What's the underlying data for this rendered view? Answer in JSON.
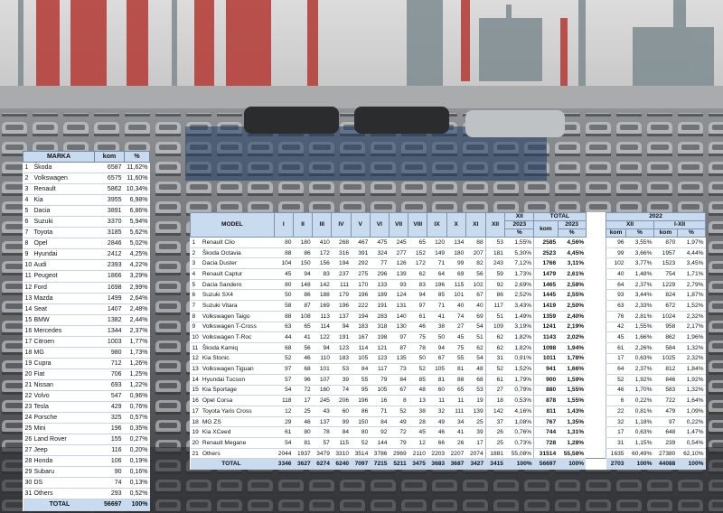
{
  "brands": {
    "headers": [
      "MARKA",
      "kom",
      "%"
    ],
    "rows": [
      [
        "1",
        "Škoda",
        "6587",
        "11,62%"
      ],
      [
        "2",
        "Volkswagen",
        "6575",
        "11,60%"
      ],
      [
        "3",
        "Renault",
        "5862",
        "10,34%"
      ],
      [
        "4",
        "Kia",
        "3955",
        "6,98%"
      ],
      [
        "5",
        "Dacia",
        "3891",
        "6,86%"
      ],
      [
        "6",
        "Suzuki",
        "3370",
        "5,94%"
      ],
      [
        "7",
        "Toyota",
        "3185",
        "5,62%"
      ],
      [
        "8",
        "Opel",
        "2846",
        "5,02%"
      ],
      [
        "9",
        "Hyundai",
        "2412",
        "4,25%"
      ],
      [
        "10",
        "Audi",
        "2393",
        "4,22%"
      ],
      [
        "11",
        "Peugeot",
        "1866",
        "3,29%"
      ],
      [
        "12",
        "Ford",
        "1698",
        "2,99%"
      ],
      [
        "13",
        "Mazda",
        "1499",
        "2,64%"
      ],
      [
        "14",
        "Seat",
        "1407",
        "2,48%"
      ],
      [
        "15",
        "BMW",
        "1382",
        "2,44%"
      ],
      [
        "16",
        "Mercedes",
        "1344",
        "2,37%"
      ],
      [
        "17",
        "Citroen",
        "1003",
        "1,77%"
      ],
      [
        "18",
        "MG",
        "980",
        "1,73%"
      ],
      [
        "19",
        "Cupra",
        "712",
        "1,26%"
      ],
      [
        "20",
        "Fiat",
        "706",
        "1,25%"
      ],
      [
        "21",
        "Nissan",
        "693",
        "1,22%"
      ],
      [
        "22",
        "Volvo",
        "547",
        "0,96%"
      ],
      [
        "23",
        "Tesla",
        "429",
        "0,76%"
      ],
      [
        "24",
        "Porsche",
        "325",
        "0,57%"
      ],
      [
        "25",
        "Mini",
        "196",
        "0,35%"
      ],
      [
        "26",
        "Land Rover",
        "155",
        "0,27%"
      ],
      [
        "27",
        "Jeep",
        "116",
        "0,20%"
      ],
      [
        "28",
        "Honda",
        "106",
        "0,19%"
      ],
      [
        "29",
        "Subaru",
        "90",
        "0,16%"
      ],
      [
        "30",
        "DS",
        "74",
        "0,13%"
      ],
      [
        "31",
        "Others",
        "293",
        "0,52%"
      ]
    ],
    "total": [
      "TOTAL",
      "56697",
      "100%"
    ]
  },
  "models": {
    "head": {
      "model": "MODEL",
      "months": [
        "I",
        "II",
        "III",
        "IV",
        "V",
        "VI",
        "VII",
        "VIII",
        "IX",
        "X",
        "XI",
        "XII"
      ],
      "xii": "XII",
      "xii_year": "2023",
      "xii_pct": "%",
      "total": "TOTAL",
      "total_year": "2023",
      "total_kom": "kom",
      "total_pct": "%",
      "prev_year": "2022",
      "prev_xii": "XII",
      "prev_ixii": "I-XII",
      "kom": "kom",
      "pct": "%"
    },
    "rows": [
      [
        "1",
        "Renault Clio",
        "80",
        "180",
        "410",
        "268",
        "467",
        "475",
        "245",
        "65",
        "120",
        "134",
        "88",
        "53",
        "1,55%",
        "2585",
        "4,56%",
        "96",
        "3,55%",
        "870",
        "1,97%"
      ],
      [
        "2",
        "Škoda Octavia",
        "88",
        "86",
        "172",
        "316",
        "391",
        "324",
        "277",
        "152",
        "149",
        "180",
        "207",
        "181",
        "5,30%",
        "2523",
        "4,45%",
        "99",
        "3,66%",
        "1957",
        "4,44%"
      ],
      [
        "3",
        "Dacia Duster",
        "104",
        "150",
        "156",
        "194",
        "292",
        "77",
        "126",
        "172",
        "71",
        "99",
        "82",
        "243",
        "7,12%",
        "1766",
        "3,11%",
        "102",
        "3,77%",
        "1523",
        "3,45%"
      ],
      [
        "4",
        "Renault Captur",
        "45",
        "94",
        "83",
        "237",
        "275",
        "296",
        "139",
        "62",
        "64",
        "69",
        "56",
        "59",
        "1,73%",
        "1479",
        "2,61%",
        "40",
        "1,48%",
        "754",
        "1,71%"
      ],
      [
        "5",
        "Dacia Sandero",
        "80",
        "148",
        "142",
        "111",
        "170",
        "133",
        "93",
        "83",
        "196",
        "115",
        "102",
        "92",
        "2,69%",
        "1465",
        "2,58%",
        "64",
        "2,37%",
        "1229",
        "2,79%"
      ],
      [
        "6",
        "Suzuki SX4",
        "50",
        "86",
        "188",
        "179",
        "196",
        "189",
        "124",
        "94",
        "85",
        "101",
        "67",
        "86",
        "2,52%",
        "1445",
        "2,55%",
        "93",
        "3,44%",
        "824",
        "1,87%"
      ],
      [
        "7",
        "Suzuki Vitara",
        "58",
        "87",
        "169",
        "196",
        "222",
        "191",
        "131",
        "97",
        "71",
        "40",
        "40",
        "117",
        "3,43%",
        "1419",
        "2,50%",
        "63",
        "2,33%",
        "672",
        "1,52%"
      ],
      [
        "8",
        "Volkswagen Taigo",
        "88",
        "108",
        "113",
        "137",
        "194",
        "283",
        "140",
        "61",
        "41",
        "74",
        "69",
        "51",
        "1,49%",
        "1359",
        "2,40%",
        "76",
        "2,81%",
        "1024",
        "2,32%"
      ],
      [
        "9",
        "Volkswagen T-Cross",
        "63",
        "65",
        "114",
        "94",
        "183",
        "318",
        "130",
        "46",
        "38",
        "27",
        "54",
        "109",
        "3,19%",
        "1241",
        "2,19%",
        "42",
        "1,55%",
        "958",
        "2,17%"
      ],
      [
        "10",
        "Volkswagen T-Roc",
        "44",
        "41",
        "122",
        "191",
        "167",
        "198",
        "97",
        "75",
        "50",
        "45",
        "51",
        "62",
        "1,82%",
        "1143",
        "2,02%",
        "45",
        "1,66%",
        "862",
        "1,96%"
      ],
      [
        "11",
        "Škoda Kamiq",
        "68",
        "56",
        "94",
        "123",
        "114",
        "121",
        "87",
        "78",
        "94",
        "75",
        "62",
        "62",
        "1,82%",
        "1098",
        "1,94%",
        "61",
        "2,26%",
        "584",
        "1,32%"
      ],
      [
        "12",
        "Kia Stonic",
        "52",
        "46",
        "110",
        "183",
        "105",
        "123",
        "135",
        "50",
        "67",
        "55",
        "54",
        "31",
        "0,91%",
        "1011",
        "1,78%",
        "17",
        "0,63%",
        "1025",
        "2,32%"
      ],
      [
        "13",
        "Volkswagen Tiguan",
        "97",
        "68",
        "101",
        "53",
        "84",
        "117",
        "73",
        "52",
        "105",
        "81",
        "48",
        "52",
        "1,52%",
        "941",
        "1,66%",
        "64",
        "2,37%",
        "812",
        "1,84%"
      ],
      [
        "14",
        "Hyundai Tucson",
        "57",
        "96",
        "107",
        "39",
        "55",
        "79",
        "84",
        "85",
        "81",
        "88",
        "68",
        "61",
        "1,79%",
        "900",
        "1,59%",
        "52",
        "1,92%",
        "846",
        "1,92%"
      ],
      [
        "15",
        "Kia Sportage",
        "54",
        "72",
        "160",
        "74",
        "95",
        "105",
        "67",
        "48",
        "60",
        "65",
        "53",
        "27",
        "0,79%",
        "880",
        "1,55%",
        "46",
        "1,70%",
        "583",
        "1,32%"
      ],
      [
        "16",
        "Opel Corsa",
        "118",
        "17",
        "245",
        "206",
        "196",
        "16",
        "8",
        "13",
        "11",
        "11",
        "19",
        "18",
        "0,53%",
        "878",
        "1,55%",
        "6",
        "0,22%",
        "722",
        "1,64%"
      ],
      [
        "17",
        "Toyota Yaris Cross",
        "12",
        "25",
        "43",
        "60",
        "86",
        "71",
        "52",
        "38",
        "32",
        "111",
        "139",
        "142",
        "4,16%",
        "811",
        "1,43%",
        "22",
        "0,81%",
        "479",
        "1,09%"
      ],
      [
        "18",
        "MG ZS",
        "29",
        "46",
        "137",
        "99",
        "150",
        "84",
        "49",
        "28",
        "49",
        "34",
        "25",
        "37",
        "1,08%",
        "767",
        "1,35%",
        "32",
        "1,18%",
        "97",
        "0,22%"
      ],
      [
        "19",
        "Kia XCeed",
        "61",
        "80",
        "78",
        "84",
        "80",
        "92",
        "72",
        "45",
        "46",
        "41",
        "39",
        "26",
        "0,76%",
        "744",
        "1,31%",
        "17",
        "0,63%",
        "648",
        "1,47%"
      ],
      [
        "20",
        "Renault Megane",
        "54",
        "81",
        "57",
        "115",
        "52",
        "144",
        "79",
        "12",
        "66",
        "26",
        "17",
        "25",
        "0,73%",
        "728",
        "1,28%",
        "31",
        "1,15%",
        "239",
        "0,54%"
      ],
      [
        "21",
        "Others",
        "2044",
        "1937",
        "3479",
        "3310",
        "3514",
        "3786",
        "2969",
        "2110",
        "2203",
        "2207",
        "2074",
        "1881",
        "55,08%",
        "31514",
        "55,58%",
        "1635",
        "60,49%",
        "27380",
        "62,10%"
      ]
    ],
    "total": [
      "TOTAL",
      "3346",
      "3627",
      "6274",
      "6240",
      "7097",
      "7215",
      "5211",
      "3475",
      "3683",
      "3687",
      "3427",
      "3415",
      "100%",
      "56697",
      "100%",
      "2703",
      "100%",
      "44088",
      "100%"
    ]
  }
}
